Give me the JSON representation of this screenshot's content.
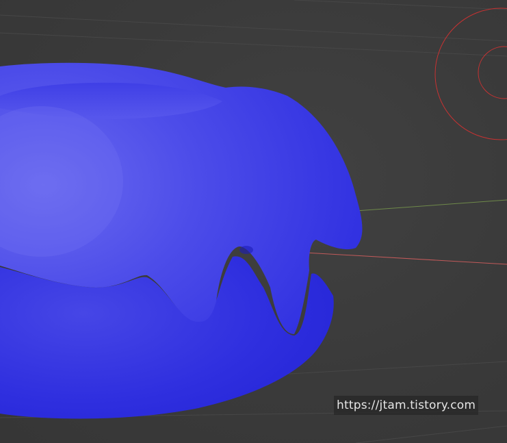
{
  "viewport": {
    "background_color": "#3a3a3a",
    "grid_line_color": "#474747",
    "axis_x_color": "#c25a5a",
    "axis_y_color": "#6f8a4a"
  },
  "objects": {
    "mesh": {
      "name_icon": "donut-mesh",
      "color": "#3636e8"
    },
    "light": {
      "name_icon": "light-gizmo-icon",
      "color": "#c83232"
    }
  },
  "watermark": {
    "text": "https://jtam.tistory.com"
  }
}
